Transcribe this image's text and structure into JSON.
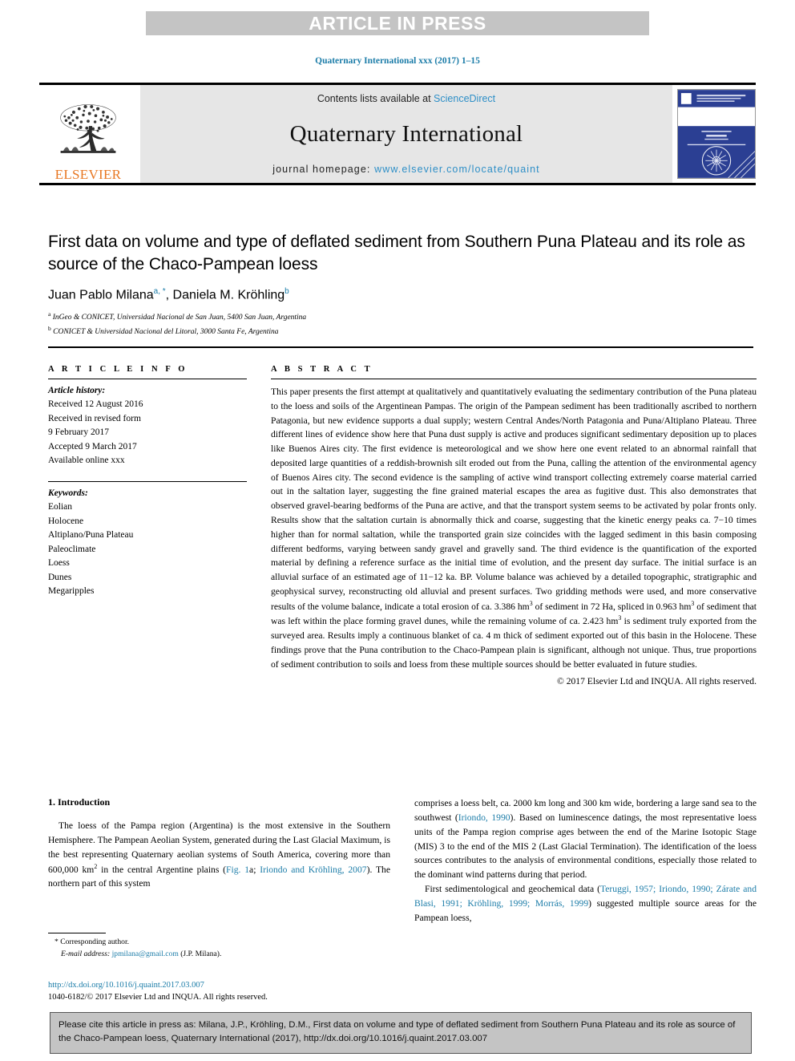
{
  "banner": {
    "label": "ARTICLE IN PRESS"
  },
  "running_citation": "Quaternary International xxx (2017) 1–15",
  "masthead": {
    "contents_prefix": "Contents lists available at ",
    "sciencedirect": "ScienceDirect",
    "journal_name": "Quaternary International",
    "homepage_prefix": "journal homepage: ",
    "homepage_url": "www.elsevier.com/locate/quaint",
    "publisher_logo_label": "ELSEVIER",
    "link_color": "#2e8fc7",
    "banner_bg": "#c4c4c4",
    "masthead_bg": "#e6e6e6",
    "elsevier_orange": "#e87722"
  },
  "article": {
    "title": "First data on volume and type of deflated sediment from Southern Puna Plateau and its role as source of the Chaco-Pampean loess",
    "authors": [
      {
        "name": "Juan Pablo Milana",
        "marks": "a, *"
      },
      {
        "name": "Daniela M. Kröhling",
        "marks": "b"
      }
    ],
    "authors_separator": ", ",
    "affiliations": [
      {
        "mark": "a",
        "text": "InGeo & CONICET, Universidad Nacional de San Juan, 5400 San Juan, Argentina"
      },
      {
        "mark": "b",
        "text": "CONICET & Universidad Nacional del Litoral, 3000 Santa Fe, Argentina"
      }
    ]
  },
  "article_info": {
    "heading": "A R T I C L E   I N F O",
    "history_label": "Article history:",
    "history": [
      "Received 12 August 2016",
      "Received in revised form",
      "9 February 2017",
      "Accepted 9 March 2017",
      "Available online xxx"
    ],
    "keywords_label": "Keywords:",
    "keywords": [
      "Eolian",
      "Holocene",
      "Altiplano/Puna Plateau",
      "Paleoclimate",
      "Loess",
      "Dunes",
      "Megaripples"
    ]
  },
  "abstract": {
    "heading": "A B S T R A C T",
    "paragraphs": [
      "This paper presents the first attempt at qualitatively and quantitatively evaluating the sedimentary contribution of the Puna plateau to the loess and soils of the Argentinean Pampas. The origin of the Pampean sediment has been traditionally ascribed to northern Patagonia, but new evidence supports a dual supply; western Central Andes/North Patagonia and Puna/Altiplano Plateau. Three different lines of evidence show here that Puna dust supply is active and produces significant sedimentary deposition up to places like Buenos Aires city. The first evidence is meteorological and we show here one event related to an abnormal rainfall that deposited large quantities of a reddish-brownish silt eroded out from the Puna, calling the attention of the environmental agency of Buenos Aires city. The second evidence is the sampling of active wind transport collecting extremely coarse material carried out in the saltation layer, suggesting the fine grained material escapes the area as fugitive dust. This also demonstrates that observed gravel-bearing bedforms of the Puna are active, and that the transport system seems to be activated by polar fronts only. Results show that the saltation curtain is abnormally thick and coarse, suggesting that the kinetic energy peaks ca. 7−10 times higher than for normal saltation, while the transported grain size coincides with the lagged sediment in this basin composing different bedforms, varying between sandy gravel and gravelly sand. The third evidence is the quantification of the exported material by defining a reference surface as the initial time of evolution, and the present day surface. The initial surface is an alluvial surface of an estimated age of 11−12 ka. BP. Volume balance was achieved by a detailed topographic, stratigraphic and geophysical survey, reconstructing old alluvial and present surfaces. Two gridding methods were used, and more conservative results of the volume balance, indicate a total erosion of ca. 3.386 hm3 of sediment in 72 Ha, spliced in 0.963 hm3 of sediment that was left within the place forming gravel dunes, while the remaining volume of ca. 2.423 hm3 is sediment truly exported from the surveyed area. Results imply a continuous blanket of ca. 4 m thick of sediment exported out of this basin in the Holocene. These findings prove that the Puna contribution to the Chaco-Pampean plain is significant, although not unique. Thus, true proportions of sediment contribution to soils and loess from these multiple sources should be better evaluated in future studies."
    ],
    "copyright": "© 2017 Elsevier Ltd and INQUA. All rights reserved."
  },
  "introduction": {
    "heading": "1. Introduction",
    "left_paragraph_1a": "The loess of the Pampa region (Argentina) is the most extensive in the Southern Hemisphere. The Pampean Aeolian System, generated during the Last Glacial Maximum, is the best representing Quaternary aeolian systems of South America, covering more than 600,000 km",
    "left_paragraph_1b": " in the central Argentine plains (",
    "left_link_1": "Fig. 1",
    "left_paragraph_1c": "a; ",
    "left_link_2": "Iriondo and Kröhling, 2007",
    "left_paragraph_1d": "). The northern part of this system",
    "superscript_km": "2",
    "right_paragraph_1a": "comprises a loess belt, ca. 2000 km long and 300 km wide, bordering a large sand sea to the southwest (",
    "right_link_1": "Iriondo, 1990",
    "right_paragraph_1b": "). Based on luminescence datings, the most representative loess units of the Pampa region comprise ages between the end of the Marine Isotopic Stage (MIS) 3 to the end of the MIS 2 (Last Glacial Termination). The identification of the loess sources contributes to the analysis of environmental conditions, especially those related to the dominant wind patterns during that period.",
    "right_paragraph_2a": "First sedimentological and geochemical data (",
    "right_link_2": "Teruggi, 1957; Iriondo, 1990; Zárate and Blasi, 1991; Kröhling, 1999; Morrás, 1999",
    "right_paragraph_2b": ") suggested multiple source areas for the Pampean loess,"
  },
  "footnote": {
    "corresponding_mark": "*",
    "corresponding_label": "Corresponding author.",
    "email_label": "E-mail address:",
    "email_address": "jpmilana@gmail.com",
    "email_owner": "(J.P. Milana)."
  },
  "doi": {
    "link": "http://dx.doi.org/10.1016/j.quaint.2017.03.007",
    "issn_line": "1040-6182/© 2017 Elsevier Ltd and INQUA. All rights reserved."
  },
  "cite_footer": {
    "text": "Please cite this article in press as: Milana, J.P., Kröhling, D.M., First data on volume and type of deflated sediment from Southern Puna Plateau and its role as source of the Chaco-Pampean loess, Quaternary International (2017), http://dx.doi.org/10.1016/j.quaint.2017.03.007"
  },
  "colors": {
    "link_blue": "#1b7ca8",
    "banner_gray": "#c4c4c4",
    "masthead_gray": "#e6e6e6",
    "cover_blue": "#2b3f93"
  }
}
